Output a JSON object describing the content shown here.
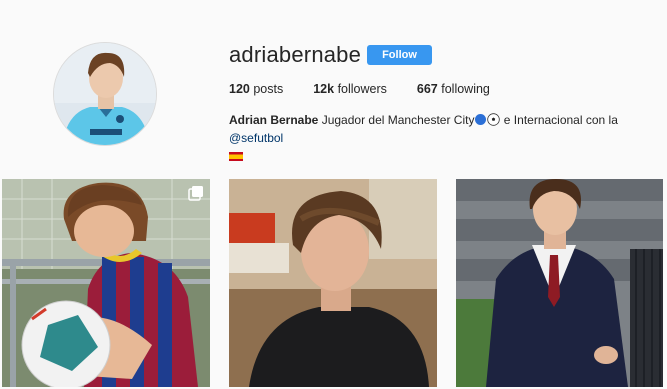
{
  "profile": {
    "username": "adriabernabe",
    "follow_label": "Follow",
    "stats": {
      "posts_count": "120",
      "posts_label": "posts",
      "followers_count": "12k",
      "followers_label": "followers",
      "following_count": "667",
      "following_label": "following"
    },
    "bio": {
      "full_name": "Adrian Bernabe",
      "text_before": "Jugador del Manchester City",
      "text_middle": "e Internacional con la",
      "mention": "@sefutbol"
    }
  },
  "icons": {
    "avatar": "avatar",
    "blue-circle": "blue-circle-emoji",
    "soccer-ball": "soccer-ball-emoji",
    "spain-flag": "spain-flag-emoji",
    "multiple-posts": "multiple-posts-icon"
  },
  "colors": {
    "follow_button": "#3897f0",
    "mention_link": "#003569",
    "background": "#fafafa"
  }
}
